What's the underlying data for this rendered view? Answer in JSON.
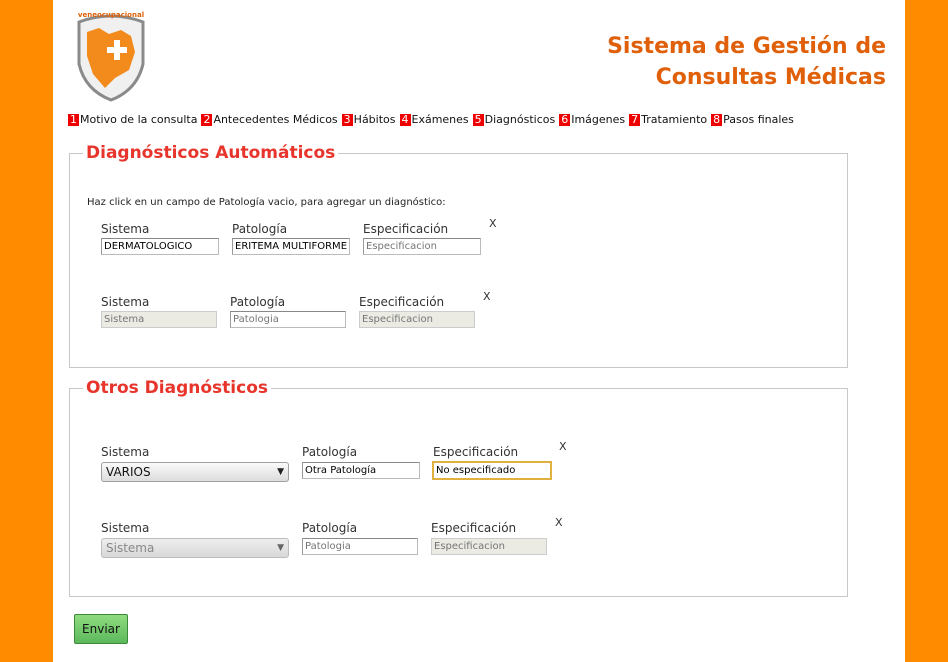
{
  "logo": {
    "text": "veneocupacional",
    "alt": "logo-icon"
  },
  "header": {
    "title_line1": "Sistema de Gestión de",
    "title_line2": "Consultas Médicas"
  },
  "steps": [
    {
      "num": "1",
      "label": "Motivo de la consulta"
    },
    {
      "num": "2",
      "label": "Antecedentes Médicos"
    },
    {
      "num": "3",
      "label": "Hábitos"
    },
    {
      "num": "4",
      "label": "Exámenes"
    },
    {
      "num": "5",
      "label": "Diagnósticos"
    },
    {
      "num": "6",
      "label": "Imágenes"
    },
    {
      "num": "7",
      "label": "Tratamiento"
    },
    {
      "num": "8",
      "label": "Pasos finales"
    }
  ],
  "auto": {
    "legend": "Diagnósticos Automáticos",
    "hint": "Haz click en un campo de Patología vacio, para agregar un diagnóstico:",
    "rows": [
      {
        "sistema_label": "Sistema",
        "sistema_value": "DERMATOLÓGICO",
        "patologia_label": "Patología",
        "patologia_value": "ERITEMA MULTIFORME",
        "espec_label": "Especificación",
        "espec_placeholder": "Especificacion",
        "remove": "X"
      },
      {
        "sistema_label": "Sistema",
        "sistema_placeholder": "Sistema",
        "patologia_label": "Patología",
        "patologia_placeholder": "Patologia",
        "espec_label": "Especificación",
        "espec_placeholder": "Especificacion",
        "remove": "X"
      }
    ]
  },
  "others": {
    "legend": "Otros Diagnósticos",
    "rows": [
      {
        "sistema_label": "Sistema",
        "sistema_value": "VARIOS",
        "patologia_label": "Patología",
        "patologia_value": "Otra Patología",
        "espec_label": "Especificación",
        "espec_value": "No especificado",
        "remove": "X"
      },
      {
        "sistema_label": "Sistema",
        "sistema_value": "Sistema",
        "patologia_label": "Patología",
        "patologia_placeholder": "Patologia",
        "espec_label": "Especificación",
        "espec_placeholder": "Especificacion",
        "remove": "X"
      }
    ]
  },
  "submit_label": "Enviar"
}
